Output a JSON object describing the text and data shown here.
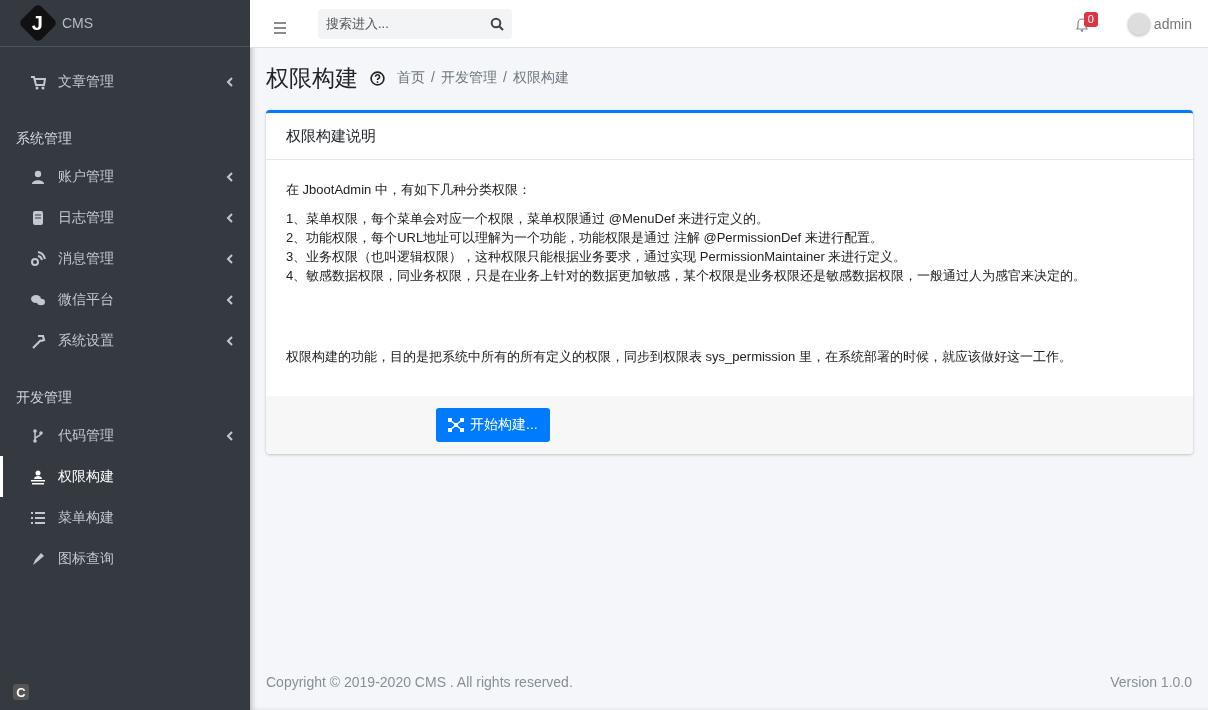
{
  "sidebar": {
    "brand": {
      "logo_letter": "J",
      "name": "CMS"
    },
    "sections": [
      {
        "items": [
          {
            "label": "文章管理",
            "expandable": true,
            "selected": false
          }
        ]
      },
      {
        "header": "系统管理",
        "items": [
          {
            "label": "账户管理",
            "expandable": true,
            "selected": false
          },
          {
            "label": "日志管理",
            "expandable": true,
            "selected": false
          },
          {
            "label": "消息管理",
            "expandable": true,
            "selected": false
          },
          {
            "label": "微信平台",
            "expandable": true,
            "selected": false
          },
          {
            "label": "系统设置",
            "expandable": true,
            "selected": false
          }
        ]
      },
      {
        "header": "开发管理",
        "items": [
          {
            "label": "代码管理",
            "expandable": true,
            "selected": false
          },
          {
            "label": "权限构建",
            "expandable": false,
            "selected": true
          },
          {
            "label": "菜单构建",
            "expandable": false,
            "selected": false
          },
          {
            "label": "图标查询",
            "expandable": false,
            "selected": false
          }
        ]
      }
    ],
    "corner_badge": "C"
  },
  "topbar": {
    "search": {
      "placeholder": "搜索进入..."
    },
    "notifications": {
      "count": "0"
    },
    "user": {
      "name": "admin"
    }
  },
  "page_header": {
    "title": "权限构建",
    "breadcrumb": {
      "separator": "/",
      "items": [
        "首页",
        "开发管理",
        "权限构建"
      ]
    }
  },
  "card": {
    "title": "权限构建说明",
    "intro": "在 JbootAdmin 中，有如下几种分类权限：",
    "list": [
      "1、菜单权限，每个菜单会对应一个权限，菜单权限通过 @MenuDef 来进行定义的。",
      "2、功能权限，每个URL地址可以理解为一个功能，功能权限是通过 注解 @PermissionDef 来进行配置。",
      "3、业务权限（也叫逻辑权限），这种权限只能根据业务要求，通过实现 PermissionMaintainer 来进行定义。",
      "4、敏感数据权限，同业务权限，只是在业务上针对的数据更加敏感，某个权限是业务权限还是敏感数据权限，一般通过人为感官来决定的。"
    ],
    "summary": "权限构建的功能，目的是把系统中所有的所有定义的权限，同步到权限表 sys_permission 里，在系统部署的时候，就应该做好这一工作。",
    "button": "开始构建..."
  },
  "footer": {
    "copyright": "Copyright © 2019-2020 CMS . All rights reserved.",
    "version": "Version 1.0.0"
  }
}
